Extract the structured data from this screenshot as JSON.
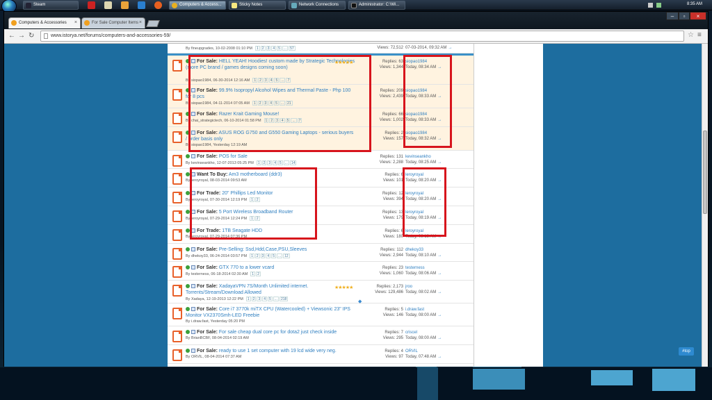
{
  "taskbar": {
    "items": [
      {
        "label": "Steam",
        "active": false
      },
      {
        "label": "Computers & Access...",
        "active": true
      },
      {
        "label": "Sticky Notes",
        "active": false
      },
      {
        "label": "Network Connections",
        "active": false
      },
      {
        "label": "Administrator: C:\\Wi...",
        "active": false
      }
    ],
    "clock": "8:35 AM"
  },
  "browser": {
    "tabs": [
      {
        "label": "Computers & Accessories",
        "active": true
      },
      {
        "label": "For Sale Computer Items",
        "active": false
      }
    ],
    "url": "www.istorya.net/forums/computers-and-accessories-59/"
  },
  "forum": {
    "top_row": {
      "meta": "By fineupgrades, 10-02-2008 01:10 PM",
      "pages": [
        "1",
        "2",
        "3",
        "4",
        "5",
        "...",
        "57"
      ],
      "stats_views": "Views: 72,512",
      "last": "07-03-2014, 09:32 AM"
    },
    "threads": [
      {
        "prefix": "For Sale:",
        "title": "HELL YEAH! Hoodies! custom made by Strategic Technologies (more PC brand / games designs coming soon)",
        "meta": "By siopao1984, 06-30-2014 12:16 AM",
        "pages": [
          "1",
          "2",
          "3",
          "4",
          "5",
          "...",
          "7"
        ],
        "stars": "★★★★★",
        "replies": "Replies: 63",
        "views": "Views: 1,344",
        "last_user": "siopao1984",
        "last_time": "Today, 08:34 AM",
        "highlight": true
      },
      {
        "prefix": "For Sale:",
        "title": "99.9% Isopropyl Alcohol Wipes and Thermal Paste - Php 100 for 8 pcs",
        "meta": "By siopao1984, 04-11-2014 07:05 AM",
        "pages": [
          "1",
          "2",
          "3",
          "4",
          "5",
          "...",
          "21"
        ],
        "stars": "",
        "replies": "Replies: 209",
        "views": "Views: 2,439",
        "last_user": "siopao1984",
        "last_time": "Today, 08:33 AM",
        "highlight": true
      },
      {
        "prefix": "For Sale:",
        "title": "Razer Krait Gaming Mouse!",
        "meta": "By chai_strategictech, 06-10-2014 01:58 PM",
        "pages": [
          "1",
          "2",
          "3",
          "4",
          "5",
          "...",
          "7"
        ],
        "stars": "",
        "replies": "Replies: 66",
        "views": "Views: 1,002",
        "last_user": "siopao1984",
        "last_time": "Today, 08:33 AM",
        "highlight": true
      },
      {
        "prefix": "For Sale:",
        "title": "ASUS ROG G750 and G550 Gaming Laptops - serious buyers / order basis only",
        "meta": "By siopao1984, Yesterday 12:19 AM",
        "pages": [],
        "stars": "",
        "replies": "Replies: 2",
        "views": "Views: 157",
        "last_user": "siopao1984",
        "last_time": "Today, 08:32 AM",
        "highlight": true
      },
      {
        "prefix": "For Sale:",
        "title": "POS for Sale",
        "meta": "By kevinseankho, 12-07-2013 05:25 PM",
        "pages": [
          "1",
          "2",
          "3",
          "4",
          "5",
          "...",
          "14"
        ],
        "stars": "",
        "replies": "Replies: 131",
        "views": "Views: 2,288",
        "last_user": "kevinseankho",
        "last_time": "Today, 08:25 AM",
        "highlight": false
      },
      {
        "prefix": "Want To Buy:",
        "title": "Am3 motherboard (ddr3)",
        "meta": "By leroyroyal, 08-03-2014 09:53 AM",
        "pages": [],
        "stars": "",
        "replies": "Replies: 6",
        "views": "Views: 101",
        "last_user": "leroyroyal",
        "last_time": "Today, 08:20 AM",
        "highlight": false
      },
      {
        "prefix": "For Trade:",
        "title": "20\" Phillips Led Monitor",
        "meta": "By leroyroyal, 07-30-2014 12:19 PM",
        "pages": [
          "1",
          "2"
        ],
        "stars": "",
        "replies": "Replies: 12",
        "views": "Views: 394",
        "last_user": "leroyroyal",
        "last_time": "Today, 08:20 AM",
        "highlight": false
      },
      {
        "prefix": "For Sale:",
        "title": "5 Port Wireless Broadband Router",
        "meta": "By leroyroyal, 07-29-2014 12:24 PM",
        "pages": [
          "1",
          "2"
        ],
        "stars": "",
        "replies": "Replies: 13",
        "views": "Views: 179",
        "last_user": "leroyroyal",
        "last_time": "Today, 08:19 AM",
        "highlight": false
      },
      {
        "prefix": "For Trade:",
        "title": "1TB Seagate HDD",
        "meta": "By leroyroyal, 07-29-2014 07:36 PM",
        "pages": [],
        "stars": "",
        "replies": "Replies: 6",
        "views": "Views: 180",
        "last_user": "leroyroyal",
        "last_time": "Today, 08:18 AM",
        "highlight": false
      },
      {
        "prefix": "For Sale:",
        "title": "Pre-Selling: Ssd,Hdd,Case,PSU,Sleeves",
        "meta": "By dhekoy33, 06-24-2014 03:57 PM",
        "pages": [
          "1",
          "2",
          "3",
          "4",
          "5",
          "...",
          "12"
        ],
        "stars": "",
        "replies": "Replies: 112",
        "views": "Views: 2,944",
        "last_user": "dhekoy33",
        "last_time": "Today, 08:10 AM",
        "highlight": false
      },
      {
        "prefix": "For Sale:",
        "title": "GTX 770 to a lower vcard",
        "meta": "By testerness, 06-18-2014 02:30 AM",
        "pages": [
          "1",
          "2"
        ],
        "stars": "",
        "replies": "Replies: 23",
        "views": "Views: 1,060",
        "last_user": "testerness",
        "last_time": "Today, 08:06 AM",
        "highlight": false
      },
      {
        "prefix": "For Sale:",
        "title": "XadayaVPN 7S/Month Unlimited internet. Torrents/Stream/Download Allowed",
        "meta": "By Xadaya, 12-19-2013 12:22 PM",
        "pages": [
          "1",
          "2",
          "3",
          "4",
          "5",
          "...",
          "218"
        ],
        "stars": "★★★★★",
        "replies": "Replies: 2,173",
        "views": "Views: 129,486",
        "last_user": "jroo",
        "last_time": "Today, 08:02 AM",
        "highlight": false
      },
      {
        "prefix": "For Sale:",
        "title": "Core i7 3770k miTX CPU (Watercooled) + Viewsonic 23\" IPS Monitor VX2370Smh-LED Freebie",
        "meta": "By i.draw.fast, Yesterday 05:20 PM",
        "pages": [],
        "stars": "",
        "replies": "Replies: 5",
        "views": "Views: 146",
        "last_user": "i.draw.fast",
        "last_time": "Today, 08:00 AM",
        "highlight": false
      },
      {
        "prefix": "For Sale:",
        "title": "For sale cheap dual core pc for dota2 just check inside",
        "meta": "By BrianBCBF, 08-04-2014 02:19 AM",
        "pages": [],
        "stars": "",
        "replies": "Replies: 7",
        "views": "Views: 295",
        "last_user": "criscel",
        "last_time": "Today, 08:00 AM",
        "highlight": false
      },
      {
        "prefix": "For Sale:",
        "title": "ready to use 1 set computer with 19 lcd wide very neg.",
        "meta": "By ORVIL, 08-04-2014 07:37 AM",
        "pages": [],
        "stars": "",
        "replies": "Replies: 4",
        "views": "Views: 97",
        "last_user": "ORVIL",
        "last_time": "Today, 07:48 AM",
        "highlight": false
      }
    ],
    "top_button": "#top"
  }
}
